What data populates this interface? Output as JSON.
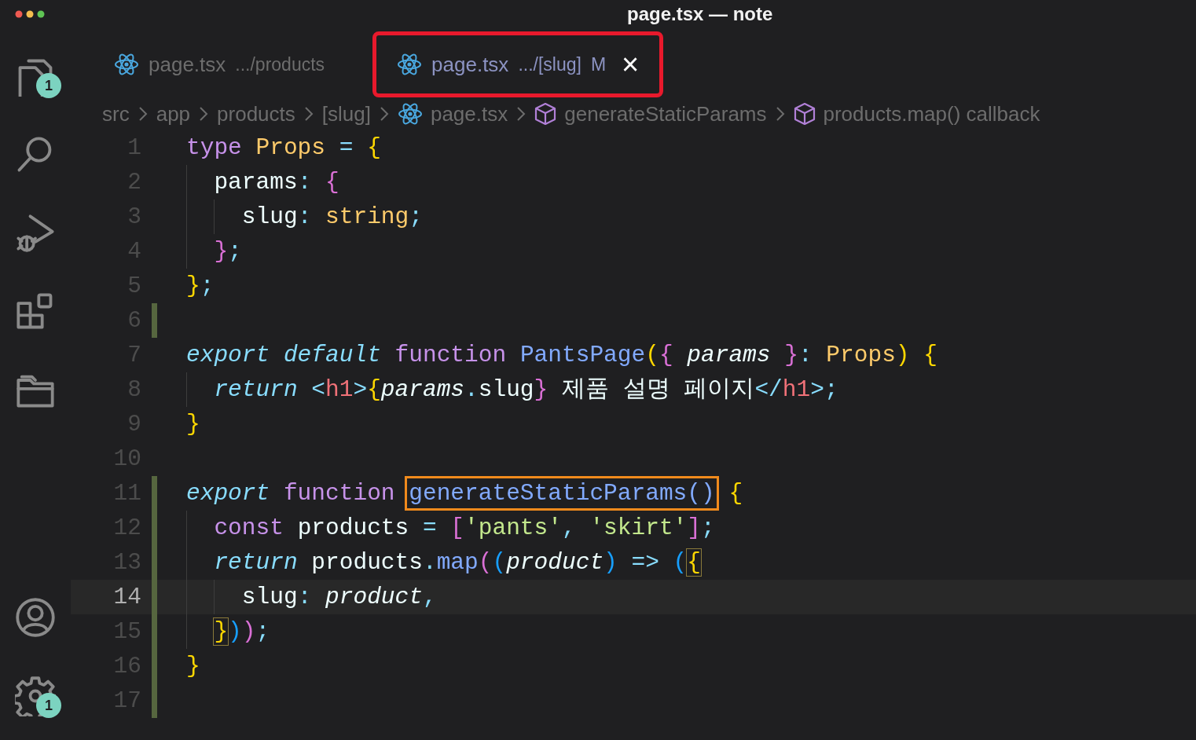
{
  "window": {
    "title": "page.tsx — note"
  },
  "activity_bar": {
    "top": [
      {
        "kind": "files",
        "badge": "1"
      },
      {
        "kind": "search"
      },
      {
        "kind": "run"
      },
      {
        "kind": "extensions"
      },
      {
        "kind": "folder"
      }
    ],
    "bottom": [
      {
        "kind": "account"
      },
      {
        "kind": "settings",
        "badge": "1"
      }
    ]
  },
  "tabs": [
    {
      "name": "page.tsx",
      "path": ".../products",
      "selected": false,
      "annotated": false
    },
    {
      "name": "page.tsx",
      "path": ".../[slug]",
      "selected": true,
      "modified_mark": "M",
      "close": "×",
      "annotated": true
    }
  ],
  "breadcrumbs": [
    {
      "kind": "folder",
      "text": "src"
    },
    {
      "kind": "folder",
      "text": "app"
    },
    {
      "kind": "folder",
      "text": "products"
    },
    {
      "kind": "folder",
      "text": "[slug]"
    },
    {
      "kind": "file",
      "text": "page.tsx"
    },
    {
      "kind": "symbol",
      "text": "generateStaticParams"
    },
    {
      "kind": "symbol",
      "text": "products.map() callback"
    }
  ],
  "editor": {
    "lines": [
      {
        "number": "1",
        "current": false,
        "modified": false,
        "tokens": [
          {
            "kind": "keyword",
            "text": "type "
          },
          {
            "kind": "type",
            "text": "Props "
          },
          {
            "kind": "op",
            "text": "= "
          },
          {
            "kind": "b1",
            "text": "{"
          }
        ]
      },
      {
        "number": "2",
        "current": false,
        "modified": false,
        "tokens": [
          {
            "kind": "plain",
            "text": "  params"
          },
          {
            "kind": "op",
            "text": ": "
          },
          {
            "kind": "b2",
            "text": "{"
          }
        ]
      },
      {
        "number": "3",
        "current": false,
        "modified": false,
        "tokens": [
          {
            "kind": "plain",
            "text": "    slug"
          },
          {
            "kind": "op",
            "text": ": "
          },
          {
            "kind": "type",
            "text": "string"
          },
          {
            "kind": "op",
            "text": ";"
          }
        ]
      },
      {
        "number": "4",
        "current": false,
        "modified": false,
        "tokens": [
          {
            "kind": "b2",
            "text": "  }"
          },
          {
            "kind": "op",
            "text": ";"
          }
        ]
      },
      {
        "number": "5",
        "current": false,
        "modified": false,
        "tokens": [
          {
            "kind": "b1",
            "text": "}"
          },
          {
            "kind": "op",
            "text": ";"
          }
        ]
      },
      {
        "number": "6",
        "current": false,
        "modified": true
      },
      {
        "number": "7",
        "current": false,
        "modified": false,
        "tokens": [
          {
            "kind": "storage",
            "text": "export default "
          },
          {
            "kind": "keyword",
            "text": "function "
          },
          {
            "kind": "func",
            "text": "PantsPage"
          },
          {
            "kind": "b1",
            "text": "("
          },
          {
            "kind": "b2",
            "text": "{ "
          },
          {
            "kind": "param",
            "text": "params "
          },
          {
            "kind": "b2",
            "text": "}"
          },
          {
            "kind": "op",
            "text": ": "
          },
          {
            "kind": "type",
            "text": "Props"
          },
          {
            "kind": "b1",
            "text": ") "
          },
          {
            "kind": "b1",
            "text": "{"
          }
        ]
      },
      {
        "number": "8",
        "current": false,
        "modified": false,
        "tokens": [
          {
            "kind": "storage",
            "text": "  return "
          },
          {
            "kind": "op",
            "text": "<"
          },
          {
            "kind": "tag",
            "text": "h1"
          },
          {
            "kind": "op",
            "text": ">"
          },
          {
            "kind": "b1",
            "text": "{"
          },
          {
            "kind": "param",
            "text": "params"
          },
          {
            "kind": "op",
            "text": "."
          },
          {
            "kind": "plain",
            "text": "slug"
          },
          {
            "kind": "b2",
            "text": "}"
          },
          {
            "kind": "plain",
            "text": " 제품 설명 페이지"
          },
          {
            "kind": "op",
            "text": "</"
          },
          {
            "kind": "tag",
            "text": "h1"
          },
          {
            "kind": "op",
            "text": ">;"
          }
        ]
      },
      {
        "number": "9",
        "current": false,
        "modified": false,
        "tokens": [
          {
            "kind": "b1",
            "text": "}"
          }
        ]
      },
      {
        "number": "10",
        "current": false,
        "modified": false
      },
      {
        "number": "11",
        "current": false,
        "modified": true,
        "tokens": [
          {
            "kind": "storage",
            "text": "export "
          },
          {
            "kind": "keyword",
            "text": "function "
          },
          {
            "kind": "func",
            "text": "generateStaticParams()",
            "boxed": true
          },
          {
            "kind": "b1",
            "text": " {"
          }
        ]
      },
      {
        "number": "12",
        "current": false,
        "modified": true,
        "tokens": [
          {
            "kind": "keyword",
            "text": "  const "
          },
          {
            "kind": "plain",
            "text": "products "
          },
          {
            "kind": "op",
            "text": "= "
          },
          {
            "kind": "b2",
            "text": "["
          },
          {
            "kind": "string",
            "text": "'pants'"
          },
          {
            "kind": "op",
            "text": ", "
          },
          {
            "kind": "string",
            "text": "'skirt'"
          },
          {
            "kind": "b2",
            "text": "]"
          },
          {
            "kind": "op",
            "text": ";"
          }
        ]
      },
      {
        "number": "13",
        "current": false,
        "modified": true,
        "tokens": [
          {
            "kind": "storage",
            "text": "  return "
          },
          {
            "kind": "plain",
            "text": "products"
          },
          {
            "kind": "op",
            "text": "."
          },
          {
            "kind": "func",
            "text": "map"
          },
          {
            "kind": "b2",
            "text": "("
          },
          {
            "kind": "b3",
            "text": "("
          },
          {
            "kind": "param",
            "text": "product"
          },
          {
            "kind": "b3",
            "text": ") "
          },
          {
            "kind": "op",
            "text": "=> "
          },
          {
            "kind": "b3",
            "text": "("
          },
          {
            "kind": "b1",
            "text": "{",
            "bracket_match": true
          }
        ]
      },
      {
        "number": "14",
        "current": true,
        "modified": true,
        "tokens": [
          {
            "kind": "plain",
            "text": "    slug"
          },
          {
            "kind": "op",
            "text": ": "
          },
          {
            "kind": "param",
            "text": "product"
          },
          {
            "kind": "op",
            "text": ","
          }
        ]
      },
      {
        "number": "15",
        "current": false,
        "modified": true,
        "tokens": [
          {
            "kind": "b1",
            "text": "  }",
            "bracket_match": true
          },
          {
            "kind": "b3",
            "text": ")"
          },
          {
            "kind": "b2",
            "text": ")"
          },
          {
            "kind": "op",
            "text": ";"
          }
        ]
      },
      {
        "number": "16",
        "current": false,
        "modified": true,
        "tokens": [
          {
            "kind": "b1",
            "text": "}"
          }
        ]
      },
      {
        "number": "17",
        "current": false,
        "modified": true
      }
    ]
  }
}
